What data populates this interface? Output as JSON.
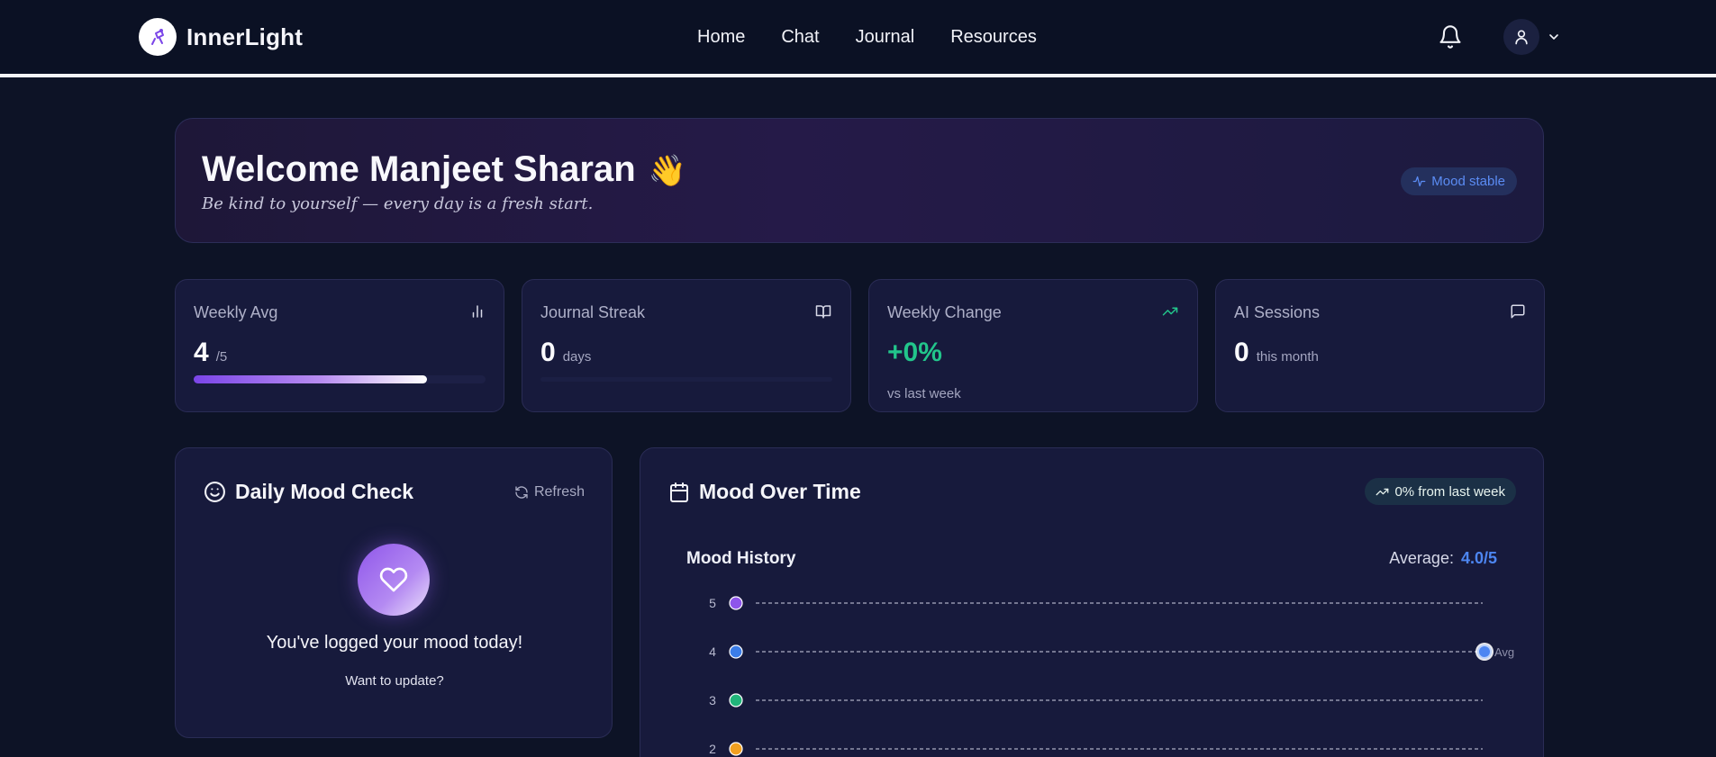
{
  "nav": {
    "brand": "InnerLight",
    "links": [
      "Home",
      "Chat",
      "Journal",
      "Resources"
    ]
  },
  "welcome": {
    "title": "Welcome Manjeet Sharan",
    "emoji": "👋",
    "subtitle": "Be kind to yourself — every day is a fresh start.",
    "status_pill": "Mood stable"
  },
  "stats": {
    "weekly_avg": {
      "label": "Weekly Avg",
      "value": "4",
      "unit": "/5",
      "progress_fraction": 0.8
    },
    "journal_streak": {
      "label": "Journal Streak",
      "value": "0",
      "unit": "days"
    },
    "weekly_change": {
      "label": "Weekly Change",
      "value": "+0%",
      "note": "vs last week"
    },
    "ai_sessions": {
      "label": "AI Sessions",
      "value": "0",
      "unit": "this month"
    }
  },
  "mood_check": {
    "title": "Daily Mood Check",
    "refresh": "Refresh",
    "message": "You've logged your mood today!",
    "update_prompt": "Want to update?"
  },
  "mood_chart": {
    "title": "Mood Over Time",
    "trend_pill": "0% from last week",
    "history_title": "Mood History",
    "average_label": "Average:",
    "average_value": "4.0/5"
  },
  "colors": {
    "accent_purple": "#7b45e8",
    "accent_blue": "#4d86f2",
    "positive_green": "#22c58b",
    "level_5": "#8e55ea",
    "level_4": "#3b7de8",
    "level_3": "#21b57a",
    "level_2": "#f0a020"
  },
  "chart_data": {
    "type": "line",
    "y_levels": [
      5,
      4,
      3,
      2
    ],
    "ylim": [
      2,
      5
    ],
    "grid": true,
    "series": [
      {
        "points": [
          4
        ]
      }
    ],
    "reference_line": {
      "label": "Avg",
      "value": 4.0
    }
  }
}
